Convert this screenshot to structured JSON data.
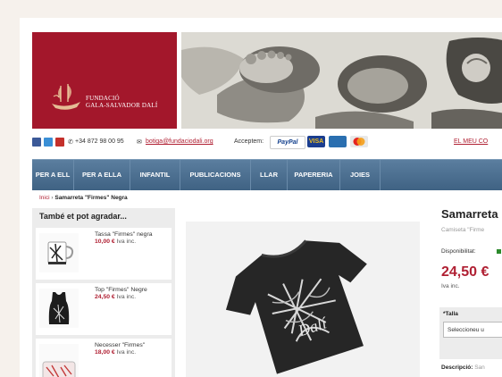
{
  "header": {
    "logo_line1": "FUNDACIÓ",
    "logo_line2": "GALA-SALVADOR DALÍ"
  },
  "contact": {
    "phone": "+34 872 98 00 95",
    "email": "botiga@fundaciodali.org",
    "accept_label": "Acceptem:",
    "paypal": "PayPal",
    "visa": "VISA",
    "my_account": "EL MEU CO"
  },
  "nav": {
    "items": [
      "PER A ELL",
      "PER A ELLA",
      "INFANTIL",
      "PUBLICACIONS",
      "LLAR",
      "PAPERERIA",
      "JOIES"
    ]
  },
  "breadcrumb": {
    "home": "Inici",
    "sep": "›",
    "current": "Samarreta \"Firmes\" Negra"
  },
  "sidebar": {
    "title": "També et pot agradar...",
    "items": [
      {
        "name": "Tassa \"Firmes\" negra",
        "price": "10,00 €",
        "vat": "Iva inc."
      },
      {
        "name": "Top \"Firmes\" Negre",
        "price": "24,50 €",
        "vat": "Iva inc."
      },
      {
        "name": "Necesser \"Firmes\"",
        "price": "18,00 €",
        "vat": "Iva inc."
      }
    ]
  },
  "product": {
    "title": "Samarreta",
    "subtitle": "Camiseta \"Firme",
    "availability_label": "Disponibilitat:",
    "price": "24,50 €",
    "price_vat": "Iva inc.",
    "size_label": "*Talla",
    "size_placeholder": "Seleccioneu u",
    "desc_label": "Descripció:",
    "desc_text": "San"
  },
  "colors": {
    "brand_red": "#a3172b",
    "nav_blue": "#4a6d8f",
    "price_red": "#b02033"
  }
}
